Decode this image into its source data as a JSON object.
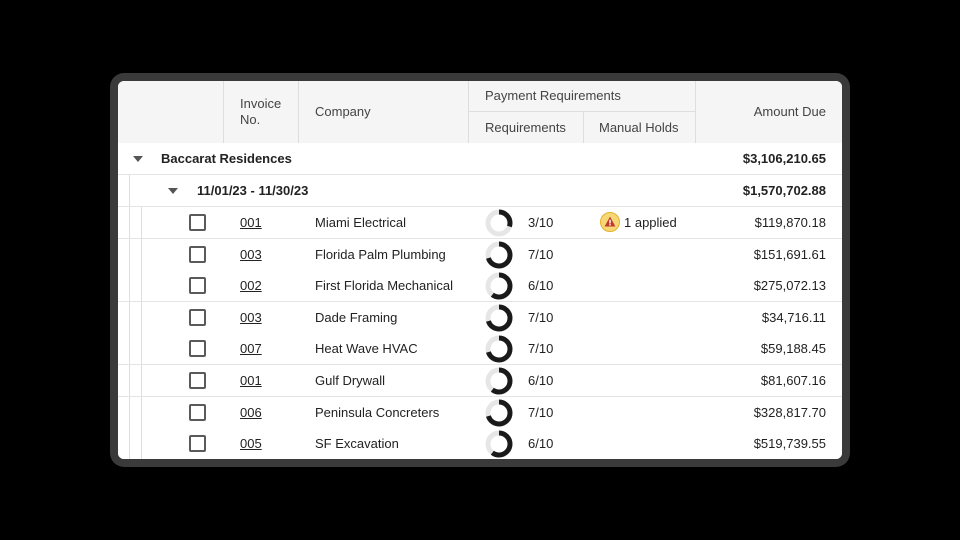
{
  "header": {
    "invoice_no": "Invoice\nNo.",
    "company": "Company",
    "payment_requirements": "Payment Requirements",
    "requirements": "Requirements",
    "manual_holds": "Manual Holds",
    "amount_due": "Amount Due"
  },
  "group": {
    "name": "Baccarat Residences",
    "amount": "$3,106,210.65",
    "period": {
      "label": "11/01/23 - 11/30/23",
      "amount": "$1,570,702.88"
    }
  },
  "rows": [
    {
      "invoice": "001",
      "company": "Miami Electrical",
      "requirements": "3/10",
      "fraction": 0.3,
      "hold": "1 applied",
      "amount": "$119,870.18"
    },
    {
      "invoice": "003",
      "company": "Florida Palm Plumbing",
      "requirements": "7/10",
      "fraction": 0.7,
      "hold": "",
      "amount": "$151,691.61"
    },
    {
      "invoice": "002",
      "company": "First Florida Mechanical",
      "requirements": "6/10",
      "fraction": 0.6,
      "hold": "",
      "amount": "$275,072.13"
    },
    {
      "invoice": "003",
      "company": "Dade Framing",
      "requirements": "7/10",
      "fraction": 0.7,
      "hold": "",
      "amount": "$34,716.11"
    },
    {
      "invoice": "007",
      "company": "Heat Wave HVAC",
      "requirements": "7/10",
      "fraction": 0.7,
      "hold": "",
      "amount": "$59,188.45"
    },
    {
      "invoice": "001",
      "company": "Gulf Drywall",
      "requirements": "6/10",
      "fraction": 0.6,
      "hold": "",
      "amount": "$81,607.16"
    },
    {
      "invoice": "006",
      "company": "Peninsula Concreters",
      "requirements": "7/10",
      "fraction": 0.7,
      "hold": "",
      "amount": "$328,817.70"
    },
    {
      "invoice": "005",
      "company": "SF Excavation",
      "requirements": "6/10",
      "fraction": 0.6,
      "hold": "",
      "amount": "$519,739.55"
    }
  ],
  "icons": {
    "group_toggle": "caret-down-icon",
    "hold_warning": "warning-triangle-icon",
    "progress": "donut-progress-icon"
  },
  "colors": {
    "link": "#2f63b8",
    "donut_fill": "#1a1a1a",
    "donut_track": "#e6e6e6",
    "warning": "#f7d775"
  }
}
